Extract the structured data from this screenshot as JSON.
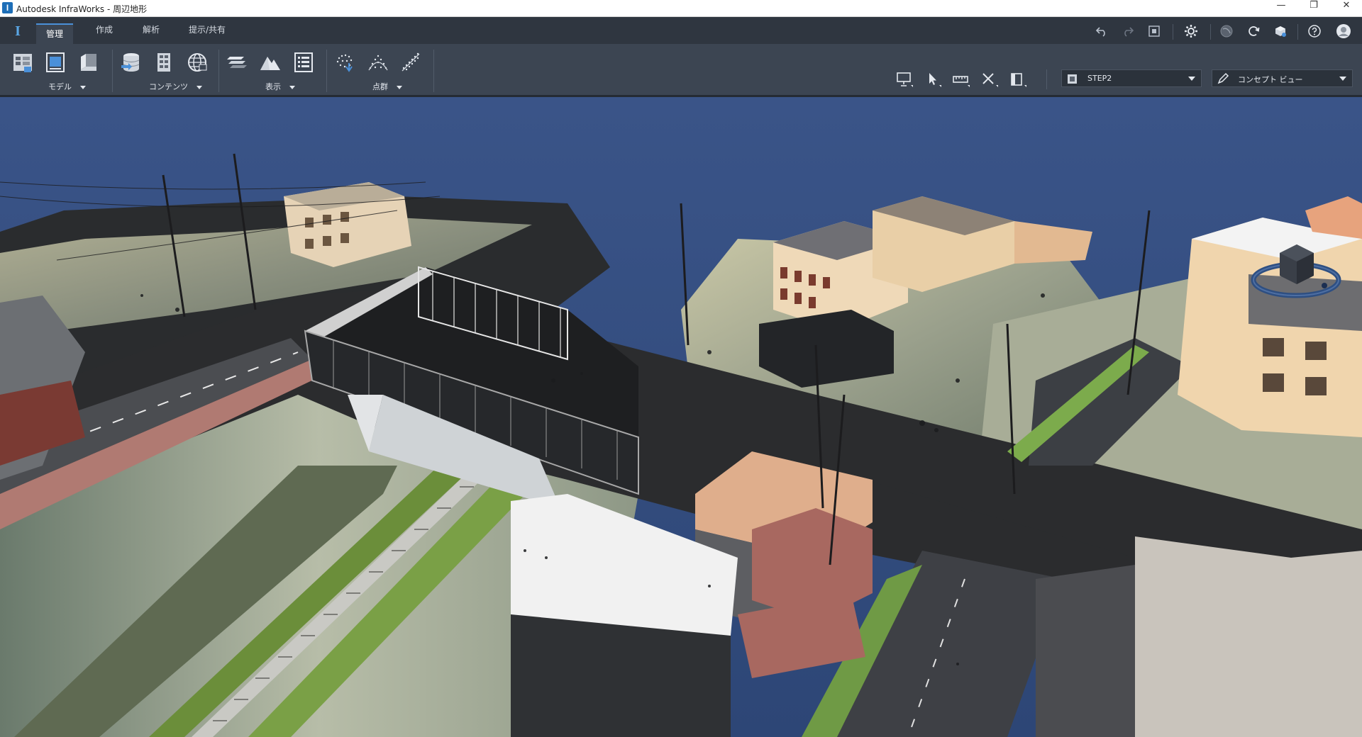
{
  "window": {
    "title": "Autodesk InfraWorks - 周辺地形",
    "minimize": "—",
    "restore": "❐",
    "close": "✕",
    "app_letter": "I"
  },
  "tabs": [
    {
      "label": "管理",
      "active": true
    },
    {
      "label": "作成"
    },
    {
      "label": "解析"
    },
    {
      "label": "提示/共有"
    }
  ],
  "ribbon": {
    "groups": [
      {
        "label": "モデル"
      },
      {
        "label": "コンテンツ"
      },
      {
        "label": "表示"
      },
      {
        "label": "点群"
      }
    ],
    "proposal_dropdown": "STEP2",
    "view_dropdown": "コンセプト ビュー"
  },
  "colors": {
    "accent": "#4a90d9",
    "sky": "#324c7e",
    "ribbon_bg": "#3c4552",
    "tab_bg": "#2f3640"
  },
  "icons": {
    "top_toolbar": [
      "undo-icon",
      "redo-icon",
      "fit-view-icon",
      "settings-gear-icon",
      "globe-icon",
      "sync-icon",
      "cloud-model-icon",
      "help-icon",
      "user-avatar-icon"
    ],
    "tools": [
      "presentation-icon",
      "select-arrow-icon",
      "measure-icon",
      "cut-tool-icon",
      "panel-icon"
    ]
  }
}
